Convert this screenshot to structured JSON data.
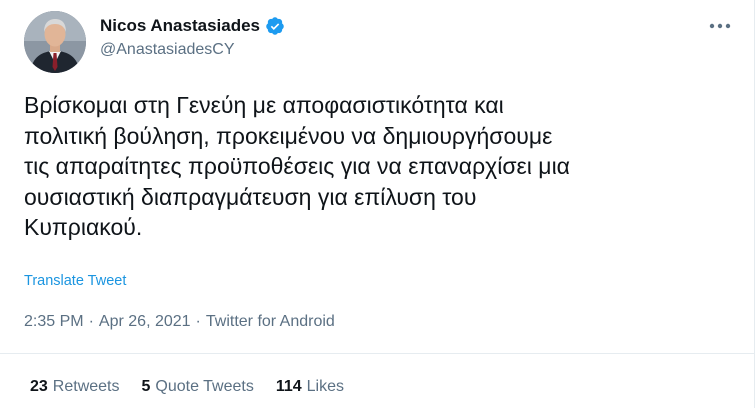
{
  "author": {
    "display_name": "Nicos Anastasiades",
    "handle": "@AnastasiadesCY",
    "verified": true,
    "verified_icon": "verified-badge-icon",
    "avatar_icon": "profile-photo"
  },
  "menu": {
    "icon": "more-horizontal-icon"
  },
  "tweet": {
    "text": "Βρίσκομαι στη Γενεύη με αποφασιστικότητα και\nπολιτική βούληση, προκειμένου να δημιουργήσουμε\nτις απαραίτητες προϋποθέσεις για να επαναρχίσει μια\nουσιαστική διαπραγμάτευση για επίλυση του\nΚυπριακού.",
    "translate_label": "Translate Tweet",
    "time": "2:35 PM",
    "separator": "·",
    "date": "Apr 26, 2021",
    "source": "Twitter for Android"
  },
  "stats": {
    "retweets_count": "23",
    "retweets_label": "Retweets",
    "quotes_count": "5",
    "quotes_label": "Quote Tweets",
    "likes_count": "114",
    "likes_label": "Likes"
  },
  "colors": {
    "accent": "#1b95e0",
    "verified": "#1d9bf0",
    "secondary_text": "#5b7083",
    "primary_text": "#0f1419",
    "border": "#e6ecf0"
  }
}
